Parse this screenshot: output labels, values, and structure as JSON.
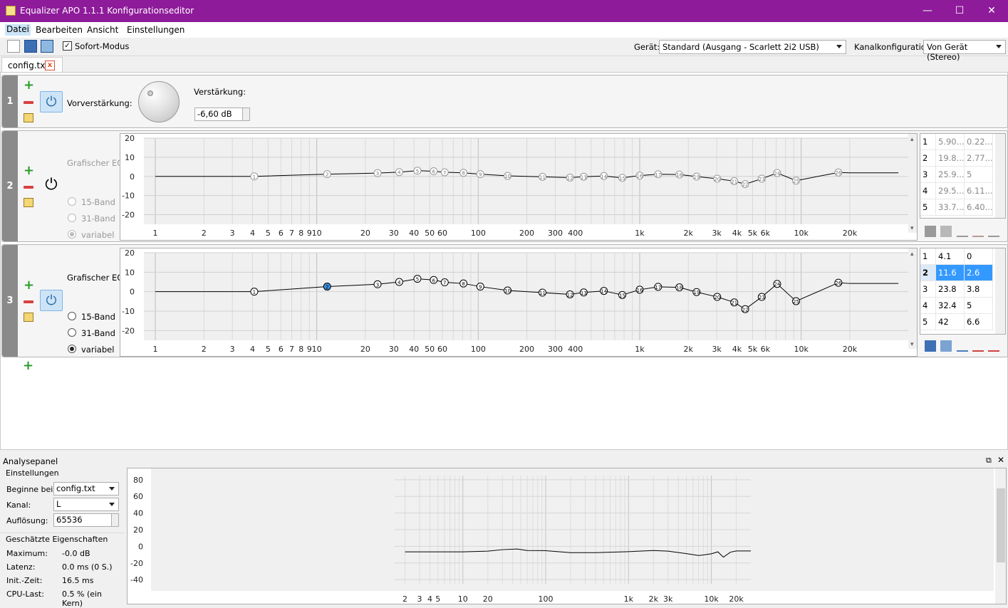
{
  "window": {
    "title": "Equalizer APO 1.1.1 Konfigurationseditor"
  },
  "menu": [
    "Datei",
    "Bearbeiten",
    "Ansicht",
    "Einstellungen"
  ],
  "toolbar": {
    "sofort_label": "Sofort-Modus",
    "sofort_checked": true,
    "geraet_label": "Gerät:",
    "geraet_value": "Standard (Ausgang - Scarlett 2i2 USB)",
    "kanal_label": "Kanalkonfiguration:",
    "kanal_value": "Von Gerät (Stereo)"
  },
  "tab": {
    "label": "config.txt"
  },
  "filter1": {
    "number": "1",
    "vor_label": "Vorverstärkung:",
    "gain_label": "Verstärkung:",
    "gain_value": "-6,60 dB"
  },
  "filter2": {
    "number": "2",
    "eq_label": "Grafischer EQ:",
    "radios": [
      "15-Band",
      "31-Band",
      "variabel"
    ],
    "table": [
      [
        "1",
        "5.90...",
        "0.22..."
      ],
      [
        "2",
        "19.8...",
        "2.77..."
      ],
      [
        "3",
        "25.9...",
        "5"
      ],
      [
        "4",
        "29.5...",
        "6.11..."
      ],
      [
        "5",
        "33.7...",
        "6.40..."
      ]
    ]
  },
  "filter3": {
    "number": "3",
    "eq_label": "Grafischer EQ:",
    "radios": [
      "15-Band",
      "31-Band",
      "variabel"
    ],
    "table": [
      [
        "1",
        "4.1",
        "0"
      ],
      [
        "2",
        "11.6",
        "2.6"
      ],
      [
        "3",
        "23.8",
        "3.8"
      ],
      [
        "4",
        "32.4",
        "5"
      ],
      [
        "5",
        "42",
        "6.6"
      ]
    ]
  },
  "eq_axis": {
    "y_ticks": [
      "20",
      "10",
      "0",
      "-10",
      "-20"
    ],
    "x_ticks": [
      "1",
      "2",
      "3",
      "4",
      "5",
      "6",
      "7",
      "8",
      "9",
      "10",
      "20",
      "30",
      "40",
      "50",
      "60",
      "100",
      "200",
      "300",
      "400",
      "1k",
      "2k",
      "3k",
      "4k",
      "5k",
      "6k",
      "10k",
      "20k"
    ]
  },
  "analyse": {
    "title": "Analysepanel",
    "settings_title": "Einstellungen",
    "beginne_label": "Beginne bei:",
    "beginne_value": "config.txt",
    "kanal_label": "Kanal:",
    "kanal_value": "L",
    "aufl_label": "Auflösung:",
    "aufl_value": "65536",
    "props_title": "Geschätzte Eigenschaften",
    "max_label": "Maximum:",
    "max_value": "-0.0 dB",
    "lat_label": "Latenz:",
    "lat_value": "0.0 ms (0 S.)",
    "init_label": "Init.-Zeit:",
    "init_value": "16.5 ms",
    "cpu_label": "CPU-Last:",
    "cpu_value": "0.5 % (ein Kern)",
    "y_ticks": [
      "80",
      "60",
      "40",
      "20",
      "0",
      "-20",
      "-40"
    ],
    "x_ticks": [
      "2",
      "3",
      "4",
      "5",
      "10",
      "20",
      "100",
      "1k",
      "2k",
      "3k",
      "10k",
      "20k"
    ]
  },
  "chart_data": [
    {
      "type": "line",
      "title": "",
      "xlabel": "",
      "ylabel": "",
      "xscale": "log",
      "ylim": [
        -25,
        20
      ],
      "series": [
        {
          "x": [
            1,
            4.1,
            11.6,
            23.8,
            32.4,
            42,
            53,
            62,
            81,
            103,
            152,
            250,
            370,
            450,
            600,
            780,
            1000,
            1300,
            1760,
            2250,
            3020,
            3850,
            4500,
            5700,
            7100,
            9300,
            17000,
            20000,
            40000
          ],
          "y": [
            0,
            0,
            2.6,
            3.8,
            5,
            6.6,
            6,
            4.8,
            4.2,
            2.6,
            0.6,
            -0.5,
            -1.4,
            -0.4,
            0.4,
            -1.7,
            1,
            2.5,
            2.2,
            -0.2,
            -2.7,
            -5.5,
            -9,
            -2.7,
            4,
            -4.9,
            4.6,
            4.2,
            4.2
          ]
        }
      ]
    },
    {
      "type": "line",
      "title": "",
      "xlabel": "",
      "ylabel": "",
      "xscale": "log",
      "ylim": [
        -45,
        85
      ],
      "series": [
        {
          "x": [
            2,
            5,
            10,
            20,
            30,
            45,
            60,
            100,
            200,
            400,
            1000,
            2000,
            3000,
            5000,
            7000,
            8000,
            10000,
            12000,
            14000,
            17000,
            20000,
            30000
          ],
          "y": [
            -6.6,
            -6.6,
            -6.6,
            -5.8,
            -4,
            -3.2,
            -5,
            -5.2,
            -7.6,
            -7.6,
            -6.4,
            -5,
            -5.8,
            -8.8,
            -11,
            -10.4,
            -9,
            -6.6,
            -13,
            -7,
            -5.6,
            -5.6
          ]
        }
      ]
    }
  ]
}
